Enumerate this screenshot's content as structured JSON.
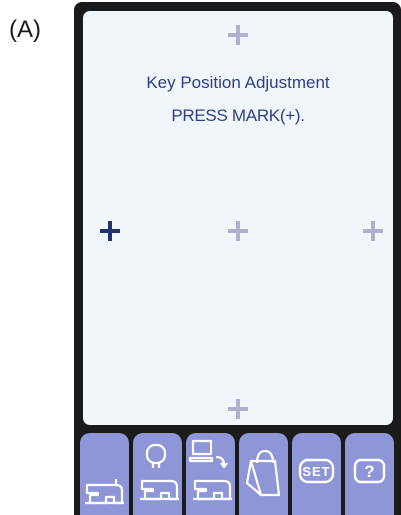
{
  "figure_label": "(A)",
  "screen": {
    "title": "Key Position Adjustment",
    "prompt": "PRESS MARK(+)."
  },
  "marks": [
    {
      "id": "top",
      "state": "inactive"
    },
    {
      "id": "left",
      "state": "active"
    },
    {
      "id": "center",
      "state": "inactive"
    },
    {
      "id": "right",
      "state": "inactive"
    },
    {
      "id": "bottom",
      "state": "inactive"
    }
  ],
  "toolbar": {
    "buttons": [
      {
        "icon": "sewing-machine-icon"
      },
      {
        "icon": "embroidery-machine-icon"
      },
      {
        "icon": "computer-connect-icon"
      },
      {
        "icon": "bag-icon"
      },
      {
        "icon": "set-icon",
        "label": "SET"
      },
      {
        "icon": "help-icon",
        "label": "?"
      }
    ]
  },
  "colors": {
    "screen_bg": "#f1f6fb",
    "text": "#2d3f8c",
    "mark_inactive": "#b2b0cc",
    "mark_active": "#23336f",
    "button_bg": "#8e96d7",
    "device_frame": "#1b1b1b"
  }
}
